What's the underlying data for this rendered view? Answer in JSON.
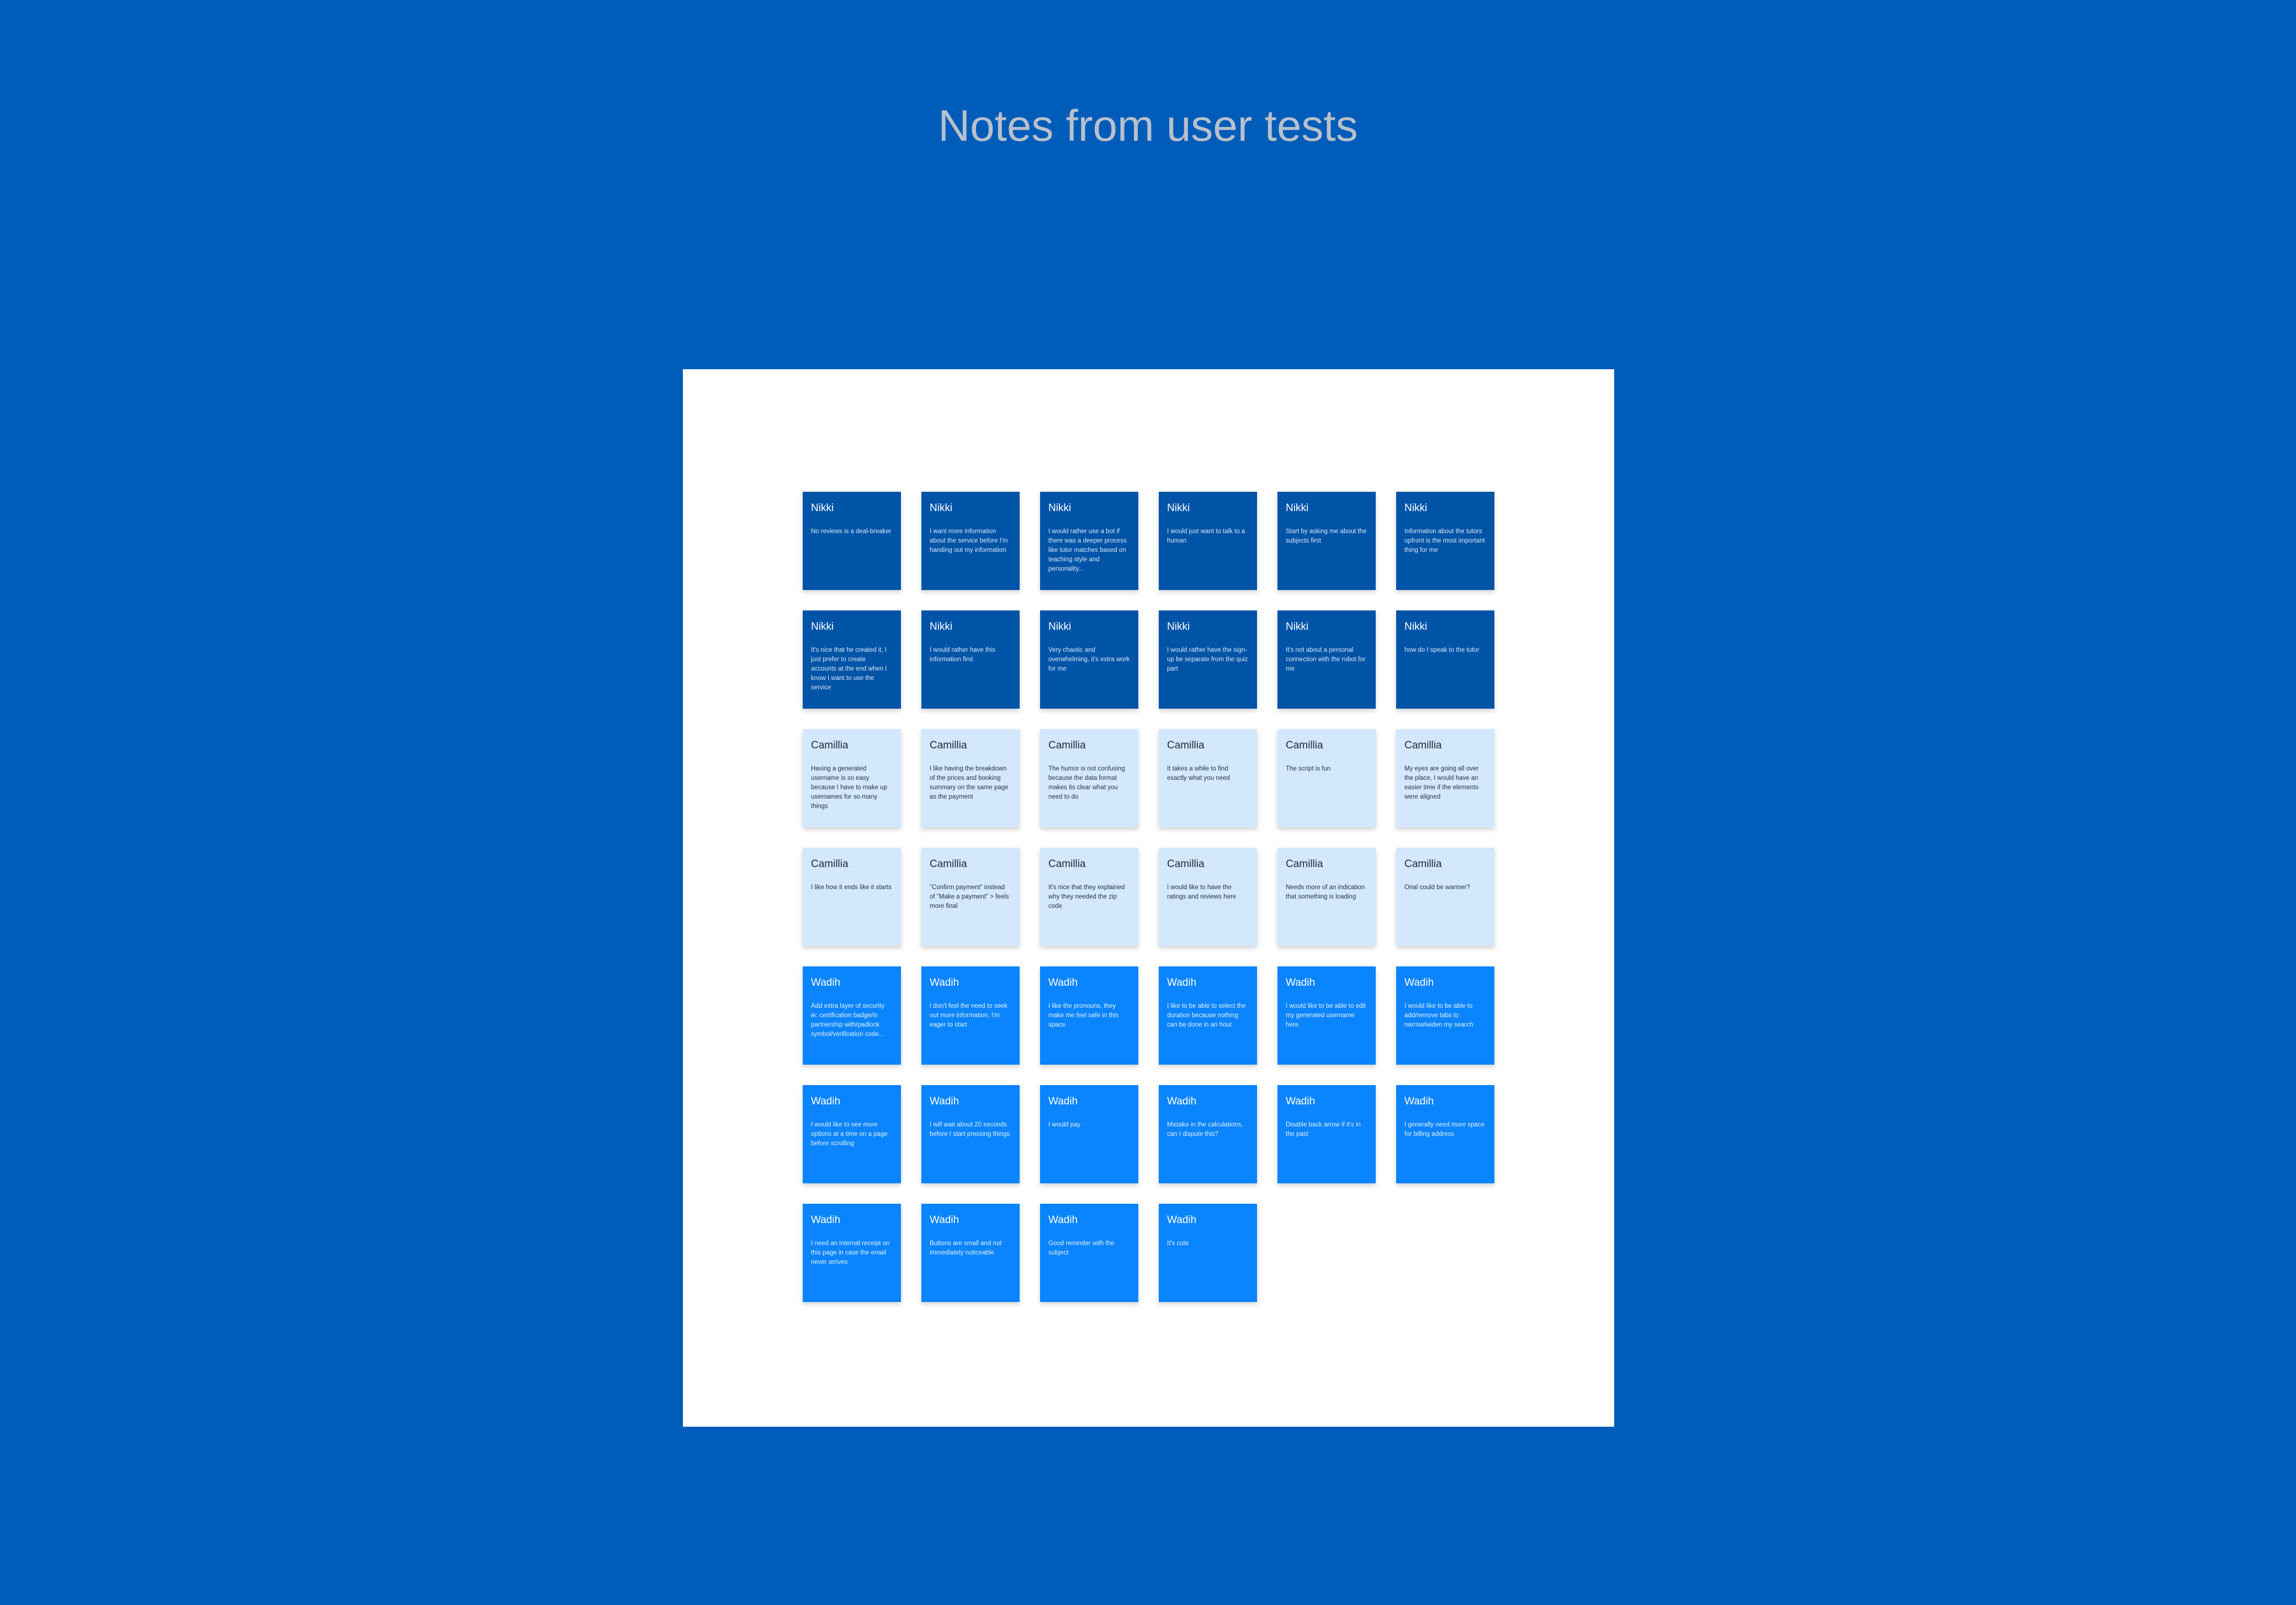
{
  "title": "Notes from user tests",
  "colors": {
    "background": "#005cb9",
    "board": "#ffffff",
    "nikki_note": "#0054a8",
    "camillia_note": "#d3e8fc",
    "wadih_note": "#0a84ff"
  },
  "notes": [
    {
      "author": "Nikki",
      "style": "dark",
      "text": "No reviews is a deal-breaker"
    },
    {
      "author": "Nikki",
      "style": "dark",
      "text": "I want more information about the service before I'm handing out my information"
    },
    {
      "author": "Nikki",
      "style": "dark",
      "text": "I would rather use a bot if there was a deeper process like tutor matches based on teaching style and personality..."
    },
    {
      "author": "Nikki",
      "style": "dark",
      "text": "I would just want to talk to a human"
    },
    {
      "author": "Nikki",
      "style": "dark",
      "text": "Start by asking me about the subjects first"
    },
    {
      "author": "Nikki",
      "style": "dark",
      "text": "Information about the tutors upfront is the most important thing for me"
    },
    {
      "author": "Nikki",
      "style": "dark",
      "text": "It's nice that he created it, I just prefer to create accounts at the end when I know I want to use the service"
    },
    {
      "author": "Nikki",
      "style": "dark",
      "text": "I would rather have this information first"
    },
    {
      "author": "Nikki",
      "style": "dark",
      "text": "Very chaotic and overwhelming, it's extra work for me"
    },
    {
      "author": "Nikki",
      "style": "dark",
      "text": "I would rather have the sign-up be separate from the quiz part"
    },
    {
      "author": "Nikki",
      "style": "dark",
      "text": "It's not about a personal connection with the robot for me"
    },
    {
      "author": "Nikki",
      "style": "dark",
      "text": "how do I speak to the tutor"
    },
    {
      "author": "Camillia",
      "style": "light",
      "text": "Having a generated username is so easy because I have to make up usernames for so many things"
    },
    {
      "author": "Camillia",
      "style": "light",
      "text": "I like having the breakdown of the prices and booking summary on the same page as the payment"
    },
    {
      "author": "Camillia",
      "style": "light",
      "text": "The humor is not confusing because the data format makes its clear what you need to do"
    },
    {
      "author": "Camillia",
      "style": "light",
      "text": "It takes a while to find exactly what you need"
    },
    {
      "author": "Camillia",
      "style": "light",
      "text": "The script is fun"
    },
    {
      "author": "Camillia",
      "style": "light",
      "text": "My eyes are going all over the place, I would have an easier time if the elements were aligned"
    },
    {
      "author": "Camillia",
      "style": "light",
      "text": "I like how it ends like it starts"
    },
    {
      "author": "Camillia",
      "style": "light",
      "text": "\"Confirm payment\" instead of \"Make a payment\" > feels more final"
    },
    {
      "author": "Camillia",
      "style": "light",
      "text": "It's nice that they explained why they needed the zip code"
    },
    {
      "author": "Camillia",
      "style": "light",
      "text": "I would like to have the ratings and reviews here"
    },
    {
      "author": "Camillia",
      "style": "light",
      "text": "Needs more of an indication that something is loading"
    },
    {
      "author": "Camillia",
      "style": "light",
      "text": "Orial could be warmer?"
    },
    {
      "author": "Wadih",
      "style": "bright",
      "text": "Add extra layer of security ie: certification badge/in partnership with/padlock symbol/verification code..."
    },
    {
      "author": "Wadih",
      "style": "bright",
      "text": "I don't feel the need to seek out more information, I'm eager to start"
    },
    {
      "author": "Wadih",
      "style": "bright",
      "text": "I like the pronouns, they make me feel safe in this space"
    },
    {
      "author": "Wadih",
      "style": "bright",
      "text": "I like to be able to select the duration because nothing can be done in an hour"
    },
    {
      "author": "Wadih",
      "style": "bright",
      "text": "I would like to be able to edit my generated username here"
    },
    {
      "author": "Wadih",
      "style": "bright",
      "text": "I would like to be able to add/remove tabs to narrow/widen my search"
    },
    {
      "author": "Wadih",
      "style": "bright",
      "text": "I would like to see more options at a time on a page before scrolling"
    },
    {
      "author": "Wadih",
      "style": "bright",
      "text": "I will wait about 20 seconds before I start pressing things"
    },
    {
      "author": "Wadih",
      "style": "bright",
      "text": "I would pay"
    },
    {
      "author": "Wadih",
      "style": "bright",
      "text": "Mistake in the calculations, can I dispute this?"
    },
    {
      "author": "Wadih",
      "style": "bright",
      "text": "Disable back arrow if it's in the past"
    },
    {
      "author": "Wadih",
      "style": "bright",
      "text": "I generally need more space for billing address"
    },
    {
      "author": "Wadih",
      "style": "bright",
      "text": "I need an internal receipt on this page in case the email never arrives"
    },
    {
      "author": "Wadih",
      "style": "bright",
      "text": "Buttons are small and not immediately noticeable"
    },
    {
      "author": "Wadih",
      "style": "bright",
      "text": "Good reminder with the subject"
    },
    {
      "author": "Wadih",
      "style": "bright",
      "text": "It's cute"
    }
  ]
}
